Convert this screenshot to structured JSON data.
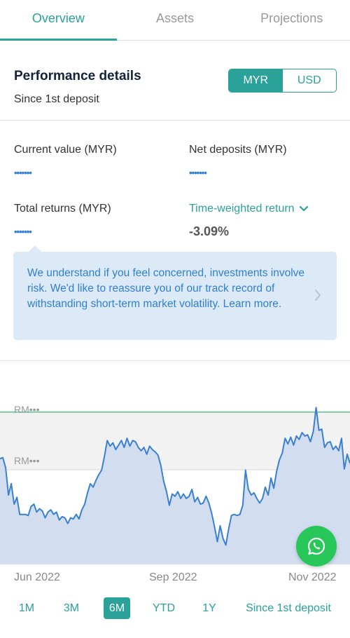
{
  "tabs": [
    {
      "label": "Overview",
      "active": true
    },
    {
      "label": "Assets",
      "active": false
    },
    {
      "label": "Projections",
      "active": false
    }
  ],
  "performance": {
    "title": "Performance details",
    "subtitle": "Since 1st deposit",
    "currency_options": [
      "MYR",
      "USD"
    ],
    "selected_currency": "MYR"
  },
  "metrics": {
    "current_value": {
      "label": "Current value (MYR)",
      "value": "•••••••"
    },
    "net_deposits": {
      "label": "Net deposits (MYR)",
      "value": "•••••••"
    },
    "total_returns": {
      "label": "Total returns (MYR)",
      "value": "•••••••"
    },
    "time_weighted_return": {
      "label": "Time-weighted return",
      "value": "-3.09%"
    }
  },
  "info_banner": {
    "text": "We understand if you feel concerned, investments involve risk. We'd like to reassure you of our track record of withstanding short-term market volatility. Learn more."
  },
  "chart": {
    "y_labels": [
      "RM•••",
      "RM•••"
    ],
    "x_labels": [
      "Jun 2022",
      "Sep 2022",
      "Nov 2022"
    ],
    "line_color": "#3a80d2",
    "fill_color": "#d2def0",
    "deposit_line_color": "#5cc48a"
  },
  "chart_data": {
    "type": "area",
    "x_ticks": [
      "Jun 2022",
      "Sep 2022",
      "Nov 2022"
    ],
    "values": [
      100.8,
      100.9,
      100.0,
      97.6,
      98.6,
      96.8,
      97.4,
      95.9,
      95.9,
      95.9,
      95.8,
      96.6,
      96.8,
      96.1,
      96.4,
      96.2,
      95.6,
      96.1,
      96.3,
      95.9,
      96.1,
      95.4,
      95.7,
      95.6,
      95.1,
      95.6,
      95.5,
      95.9,
      95.5,
      96.3,
      96.8,
      97.8,
      98.6,
      98.3,
      98.9,
      99.4,
      99.8,
      101.0,
      102.4,
      101.9,
      102.2,
      101.6,
      102.0,
      102.4,
      101.8,
      102.6,
      101.9,
      102.4,
      102.3,
      101.8,
      101.5,
      101.8,
      101.2,
      101.9,
      101.6,
      101.4,
      101.1,
      100.2,
      98.8,
      97.9,
      96.7,
      97.7,
      97.5,
      97.9,
      97.3,
      97.7,
      97.3,
      97.5,
      98.1,
      97.0,
      97.4,
      96.8,
      96.9,
      97.5,
      96.9,
      96.0,
      94.8,
      93.5,
      94.9,
      93.8,
      93.2,
      94.6,
      95.8,
      95.9,
      95.8,
      95.9,
      96.7,
      99.8,
      98.1,
      97.6,
      97.8,
      97.3,
      96.9,
      97.3,
      98.3,
      97.6,
      99.1,
      98.2,
      99.7,
      100.7,
      101.3,
      102.6,
      102.1,
      102.7,
      102.0,
      102.8,
      102.5,
      103.1,
      102.8,
      102.9,
      102.3,
      103.2,
      105.3,
      103.3,
      103.4,
      101.8,
      102.2,
      102.3,
      101.6,
      101.9,
      101.5,
      102.6,
      99.9,
      101.2,
      100.4
    ],
    "ylim": [
      91.5,
      106
    ],
    "reference_line": 104.9
  },
  "time_ranges": [
    "1M",
    "3M",
    "6M",
    "YTD",
    "1Y",
    "Since 1st deposit"
  ],
  "selected_range": "6M"
}
